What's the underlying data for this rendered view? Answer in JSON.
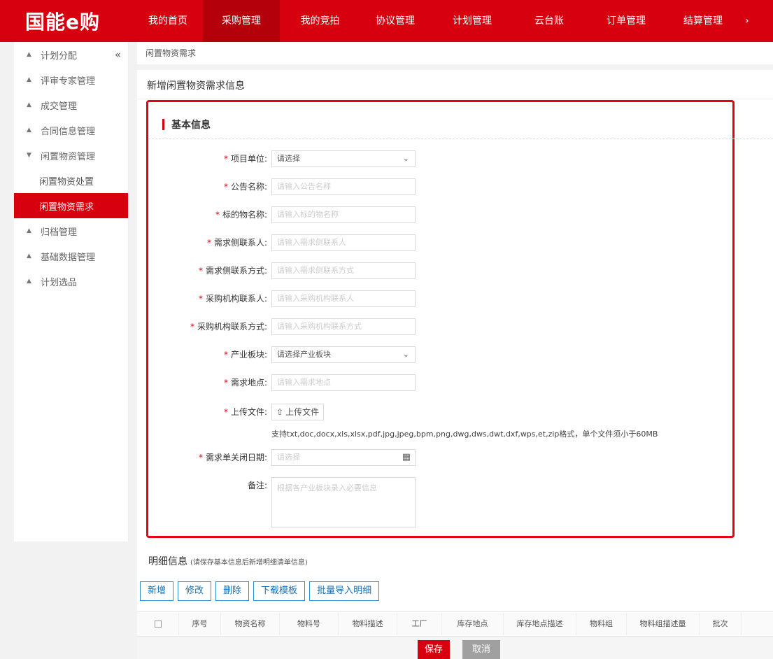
{
  "app": {
    "logo_text": "国能e购"
  },
  "topnav": {
    "items": [
      {
        "label": "我的首页",
        "active": false
      },
      {
        "label": "采购管理",
        "active": true
      },
      {
        "label": "我的竞拍",
        "active": false
      },
      {
        "label": "协议管理",
        "active": false
      },
      {
        "label": "计划管理",
        "active": false
      },
      {
        "label": "云台账",
        "active": false
      },
      {
        "label": "订单管理",
        "active": false
      },
      {
        "label": "结算管理",
        "active": false
      }
    ],
    "more_icon": "chevron-right-icon"
  },
  "sidebar": {
    "collapse_icon": "double-chevron-left-icon",
    "items": [
      {
        "label": "计划分配",
        "expanded": false
      },
      {
        "label": "评审专家管理",
        "expanded": false
      },
      {
        "label": "成交管理",
        "expanded": false
      },
      {
        "label": "合同信息管理",
        "expanded": false
      },
      {
        "label": "闲置物资管理",
        "expanded": true
      },
      {
        "label": "闲置物资处置",
        "sub": true
      },
      {
        "label": "闲置物资需求",
        "sub": true,
        "active": true
      },
      {
        "label": "归档管理",
        "expanded": false
      },
      {
        "label": "基础数据管理",
        "expanded": false
      },
      {
        "label": "计划选品",
        "expanded": false
      }
    ]
  },
  "breadcrumb": "闲置物资需求",
  "card": {
    "title": "新增闲置物资需求信息"
  },
  "section": {
    "title": "基本信息"
  },
  "form": {
    "project_unit": {
      "label": "项目单位:",
      "value": "请选择"
    },
    "notice_name": {
      "label": "公告名称:",
      "placeholder": "请输入公告名称"
    },
    "subject_name": {
      "label": "标的物名称:",
      "placeholder": "请输入标的物名称"
    },
    "demand_contact": {
      "label": "需求侧联系人:",
      "placeholder": "请输入需求侧联系人"
    },
    "demand_phone": {
      "label": "需求侧联系方式:",
      "placeholder": "请输入需求侧联系方式"
    },
    "buyer_contact": {
      "label": "采购机构联系人:",
      "placeholder": "请输入采购机构联系人"
    },
    "buyer_phone": {
      "label": "采购机构联系方式:",
      "placeholder": "请输入采购机构联系方式"
    },
    "industry": {
      "label": "产业板块:",
      "value": "请选择产业板块"
    },
    "location": {
      "label": "需求地点:",
      "placeholder": "请输入需求地点"
    },
    "upload": {
      "label": "上传文件:",
      "button": "上传文件"
    },
    "upload_hint": "支持txt,doc,docx,xls,xlsx,pdf,jpg,jpeg,bpm,png,dwg,dws,dwt,dxf,wps,et,zip格式，单个文件须小于60MB",
    "close_date": {
      "label": "需求单关闭日期:",
      "placeholder": "请选择"
    },
    "remark": {
      "label": "备注:",
      "placeholder": "根据各产业板块录入必要信息"
    }
  },
  "detail": {
    "title": "明细信息",
    "note": "(请保存基本信息后新增明细清单信息)",
    "buttons": [
      "新增",
      "修改",
      "删除",
      "下载模板",
      "批量导入明细"
    ],
    "columns": [
      "序号",
      "物资名称",
      "物料号",
      "物料描述",
      "工厂",
      "库存地点",
      "库存地点描述",
      "物料组",
      "物料组描述量",
      "批次"
    ]
  },
  "footer": {
    "save": "保存",
    "cancel": "取消"
  },
  "colors": {
    "brand_red": "#d7000f",
    "highlight_box": "#e60012",
    "button_blue": "#2a8fd1"
  }
}
